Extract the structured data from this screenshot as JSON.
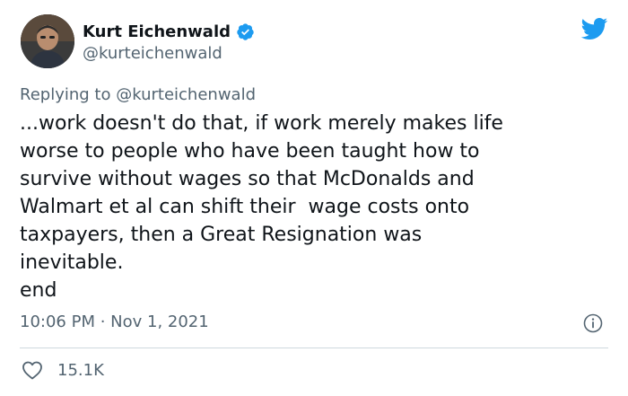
{
  "author": {
    "display_name": "Kurt Eichenwald",
    "handle": "@kurteichenwald",
    "verified": true
  },
  "reply_context": {
    "prefix": "Replying to",
    "handle": "@kurteichenwald"
  },
  "tweet": {
    "text": "...work doesn't do that, if work merely makes life\nworse to people who have been taught how to\nsurvive without wages so that McDonalds and\nWalmart et al can shift their  wage costs onto\ntaxpayers, then a Great Resignation was\ninevitable.\nend",
    "timestamp": "10:06 PM · Nov 1, 2021",
    "likes": "15.1K"
  },
  "icons": {
    "brand": "twitter-bird-icon",
    "verified": "verified-badge-icon",
    "info": "info-icon",
    "like": "heart-icon"
  },
  "colors": {
    "brand_blue": "#1d9bf0",
    "text_primary": "#0f1419",
    "text_secondary": "#536471",
    "divider": "#cfd9de"
  }
}
